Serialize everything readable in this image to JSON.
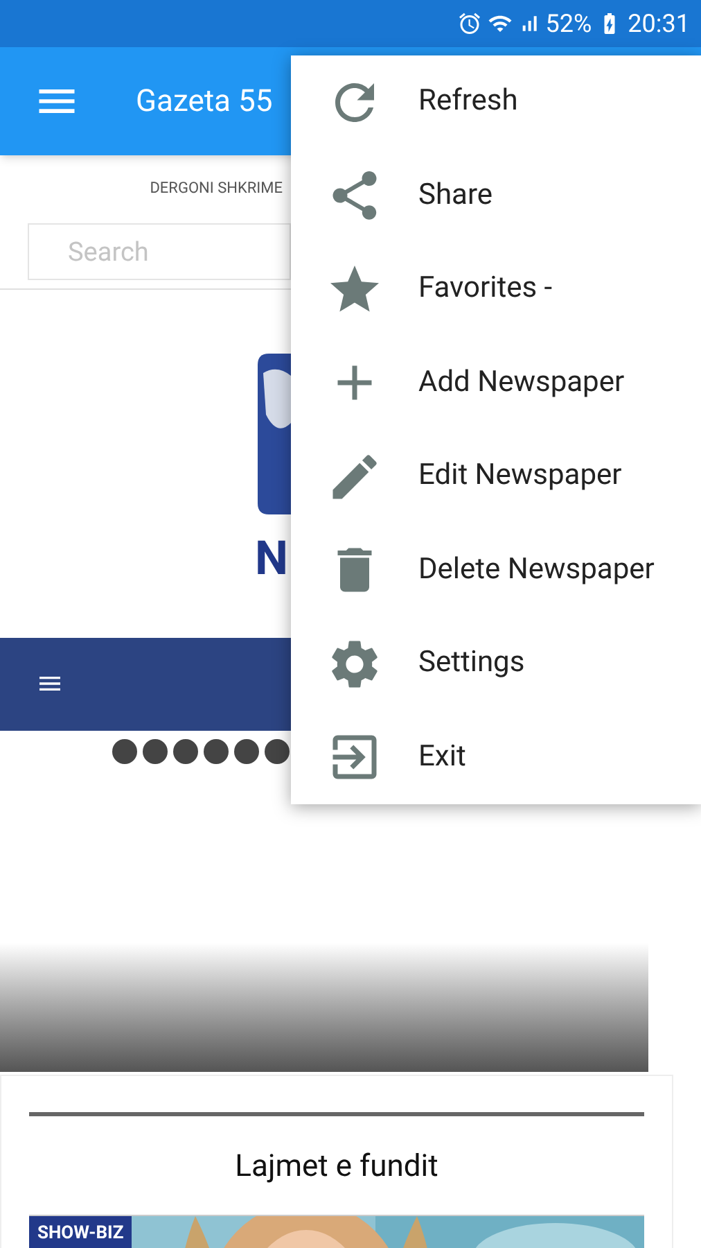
{
  "status_bar": {
    "battery": "52%",
    "time": "20:31"
  },
  "app_bar": {
    "title": "Gazeta 55"
  },
  "header_link": "DERGONI SHKRIME",
  "search": {
    "placeholder": "Search"
  },
  "logo": {
    "letter": "N"
  },
  "slider_dots": [
    {
      "selected": false
    },
    {
      "selected": false
    },
    {
      "selected": false
    },
    {
      "selected": false
    },
    {
      "selected": false
    },
    {
      "selected": false
    }
  ],
  "menu": [
    {
      "label": "Refresh"
    },
    {
      "label": "Share"
    },
    {
      "label": "Favorites -"
    },
    {
      "label": "Add Newspaper"
    },
    {
      "label": "Edit Newspaper"
    },
    {
      "label": "Delete Newspaper"
    },
    {
      "label": "Settings"
    },
    {
      "label": "Exit"
    }
  ],
  "section": {
    "title": "Lajmet e fundit",
    "tag": "SHOW-BIZ"
  }
}
